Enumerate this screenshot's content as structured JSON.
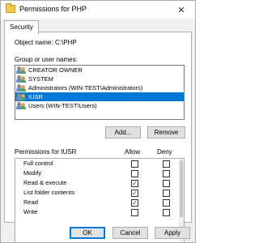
{
  "window": {
    "title": "Permissions for PHP",
    "close_glyph": "✕"
  },
  "tabs": [
    {
      "label": "Security"
    }
  ],
  "object": {
    "label": "Object name:",
    "value": "C:\\PHP"
  },
  "groups": {
    "label": "Group or user names:",
    "items": [
      {
        "label": "CREATOR OWNER",
        "selected": false
      },
      {
        "label": "SYSTEM",
        "selected": false
      },
      {
        "label": "Administrators (WIN-TEST\\Administrators)",
        "selected": false
      },
      {
        "label": "IUSR",
        "selected": true
      },
      {
        "label": "Users (WIN-TEST\\Users)",
        "selected": false
      }
    ]
  },
  "buttons": {
    "add": "Add...",
    "remove": "Remove",
    "ok": "OK",
    "cancel": "Cancel",
    "apply": "Apply"
  },
  "permissions": {
    "label": "Permissions for IUSR",
    "allow_header": "Allow",
    "deny_header": "Deny",
    "rows": [
      {
        "name": "Full control",
        "allow": false,
        "deny": false
      },
      {
        "name": "Modify",
        "allow": false,
        "deny": false
      },
      {
        "name": "Read & execute",
        "allow": true,
        "deny": false
      },
      {
        "name": "List folder contents",
        "allow": true,
        "deny": false
      },
      {
        "name": "Read",
        "allow": true,
        "deny": false
      },
      {
        "name": "Write",
        "allow": false,
        "deny": false
      }
    ]
  }
}
